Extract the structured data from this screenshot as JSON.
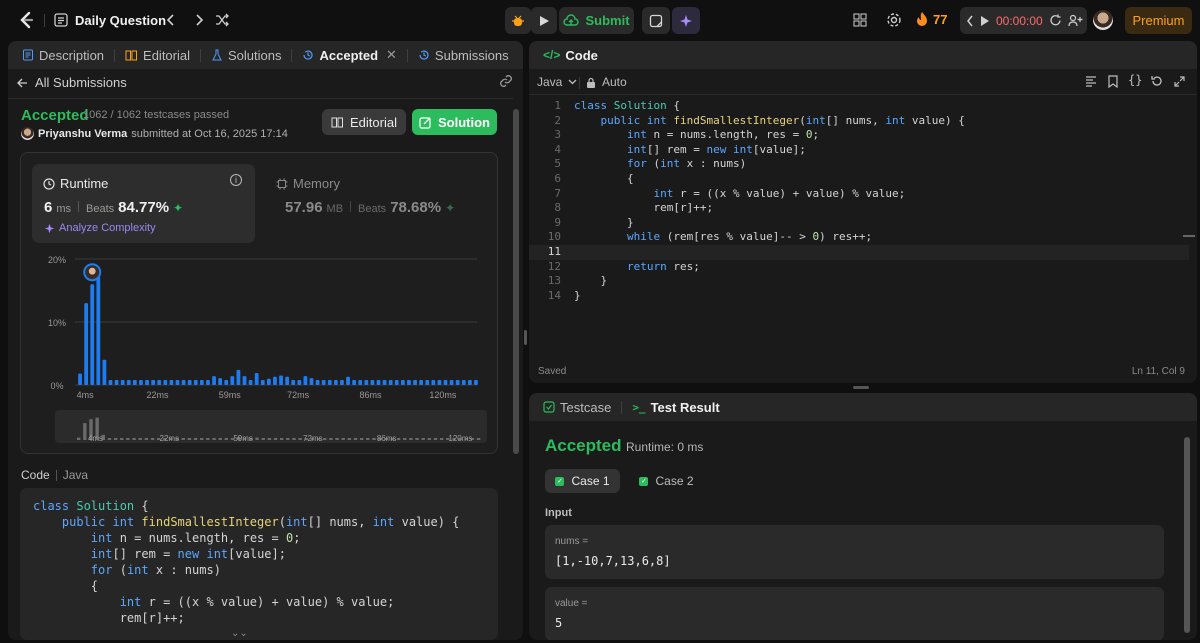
{
  "topbar": {
    "problem_list_label": "Daily Question",
    "submit_label": "Submit",
    "streak_count": "77",
    "timer": "00:00:00",
    "premium_label": "Premium"
  },
  "left": {
    "tabs": [
      {
        "label": "Description"
      },
      {
        "label": "Editorial"
      },
      {
        "label": "Solutions"
      },
      {
        "label": "Accepted"
      },
      {
        "label": "Submissions"
      }
    ],
    "back_label": "All Submissions",
    "status": "Accepted",
    "testcases": "1062 / 1062 testcases passed",
    "user": "Priyanshu Verma",
    "submitted_at": "submitted at Oct 16, 2025 17:14",
    "editorial_btn": "Editorial",
    "solution_btn": "Solution",
    "runtime": {
      "label": "Runtime",
      "value": "6",
      "unit": "ms",
      "beats_label": "Beats",
      "beats": "84.77%",
      "analyze": "Analyze Complexity"
    },
    "memory": {
      "label": "Memory",
      "value": "57.96",
      "unit": "MB",
      "beats_label": "Beats",
      "beats": "78.68%"
    },
    "code_label": "Code",
    "code_lang": "Java"
  },
  "chart_data": {
    "type": "bar",
    "y_ticks": [
      "20%",
      "10%",
      "0%"
    ],
    "ylim": [
      0,
      20
    ],
    "x_ticks": [
      "4ms",
      "22ms",
      "59ms",
      "72ms",
      "86ms",
      "120ms"
    ],
    "values": [
      1.8,
      13,
      16,
      17.2,
      4,
      0.8,
      0.8,
      0.8,
      0.8,
      0.8,
      0.8,
      0.8,
      0.8,
      0.8,
      0.8,
      0.8,
      0.8,
      0.8,
      0.8,
      0.8,
      0.8,
      0.8,
      1.4,
      1.1,
      0.8,
      1.4,
      2.4,
      1.4,
      0.8,
      1.9,
      0.8,
      1,
      1.3,
      1.5,
      1.3,
      0.8,
      0.8,
      1.4,
      1.1,
      0.8,
      0.8,
      0.8,
      0.8,
      0.8,
      1.3,
      0.8,
      0.8,
      0.8,
      0.8,
      0.8,
      0.8,
      0.8,
      0.8,
      0.8,
      0.8,
      0.8,
      0.8,
      0.8,
      0.8,
      0.8,
      0.8,
      0.8,
      0.8,
      0.8,
      0.8,
      0.8
    ],
    "highlight_index": 2
  },
  "right": {
    "code_tab": "Code",
    "language": "Java",
    "mode": "Auto",
    "saved": "Saved",
    "cursor": "Ln 11, Col 9",
    "testcase_tab": "Testcase",
    "result_tab": "Test Result",
    "result_status": "Accepted",
    "result_runtime": "Runtime: 0 ms",
    "cases": [
      "Case 1",
      "Case 2"
    ],
    "input_label": "Input",
    "inputs": [
      {
        "name": "nums =",
        "value": "[1,-10,7,13,6,8]"
      },
      {
        "name": "value =",
        "value": "5"
      }
    ]
  },
  "editor_code": [
    "class Solution {",
    "    public int findSmallestInteger(int[] nums, int value) {",
    "        int n = nums.length, res = 0;",
    "        int[] rem = new int[value];",
    "        for (int x : nums)",
    "        {",
    "            int r = ((x % value) + value) % value;",
    "            rem[r]++;",
    "        }",
    "        while (rem[res % value]-- > 0) res++;",
    "",
    "        return res;",
    "    }",
    "}"
  ],
  "submitted_code": [
    "class Solution {",
    "    public int findSmallestInteger(int[] nums, int value) {",
    "        int n = nums.length, res = 0;",
    "        int[] rem = new int[value];",
    "        for (int x : nums)",
    "        {",
    "            int r = ((x % value) + value) % value;",
    "            rem[r]++;"
  ],
  "colors": {
    "accent_green": "#2cbb5d",
    "bar_blue": "#1e7cf2",
    "premium": "#ffa116"
  }
}
